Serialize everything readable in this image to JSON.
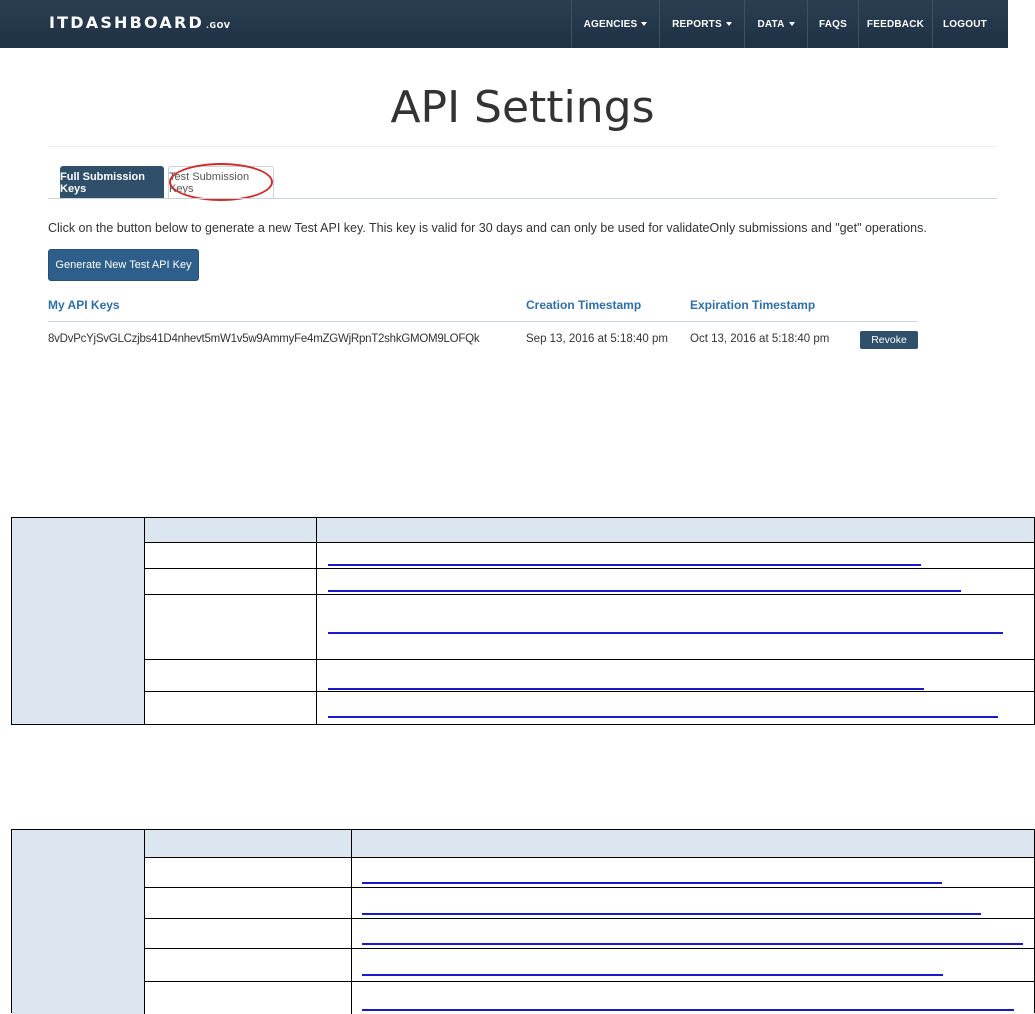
{
  "navbar": {
    "brand_main": "ITDASHBOARD",
    "brand_suffix": ".GOV",
    "items": [
      {
        "label": "AGENCIES"
      },
      {
        "label": "REPORTS"
      },
      {
        "label": "DATA"
      },
      {
        "label": "FAQS"
      },
      {
        "label": "FEEDBACK"
      },
      {
        "label": "LOGOUT"
      }
    ]
  },
  "page": {
    "title": "API Settings"
  },
  "tabs": [
    {
      "label": "Full Submission Keys",
      "active": true
    },
    {
      "label": "Test Submission Keys",
      "active": false,
      "highlighted": true
    }
  ],
  "instructions": "Click on the button below to generate a new Test API key. This key is valid for 30 days and can only be used for validateOnly submissions and \"get\" operations.",
  "generate_button": "Generate New Test API Key",
  "keys_table": {
    "headers": [
      "My API Keys",
      "Creation Timestamp",
      "Expiration Timestamp"
    ],
    "rows": [
      {
        "key": "8vDvPcYjSvGLCzjbs41D4nhevt5mW1v5w9AmmyFe4mZGWjRpnT2shkGMOM9LOFQk",
        "created": "Sep 13, 2016 at 5:18:40 pm",
        "expires": "Oct 13, 2016 at 5:18:40 pm",
        "action": "Revoke"
      }
    ]
  },
  "colors": {
    "navbar": "#22364a",
    "active_tab": "#2f4f6b",
    "link_header": "#2f6fa7",
    "highlight": "#d12a2a",
    "doc_shade": "#dce6f1",
    "doc_link": "#1a1acc"
  }
}
